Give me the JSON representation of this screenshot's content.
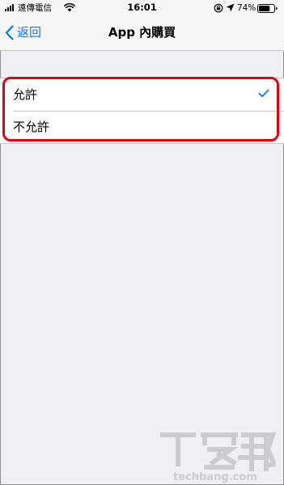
{
  "status_bar": {
    "carrier": "遠傳電信",
    "time": "16:01",
    "battery_percent": "74%",
    "battery_level": 0.74,
    "icons": [
      "signal-icon",
      "wifi-icon",
      "rotation-lock-icon",
      "location-icon",
      "battery-icon"
    ]
  },
  "nav": {
    "back_label": "返回",
    "title": "App 內購買"
  },
  "options": [
    {
      "label": "允許",
      "selected": true
    },
    {
      "label": "不允許",
      "selected": false
    }
  ],
  "colors": {
    "accent": "#007aff",
    "highlight": "#e60012",
    "background": "#efeff4"
  },
  "watermark": {
    "logo_text": "T客邦",
    "site": "techbang.com"
  }
}
